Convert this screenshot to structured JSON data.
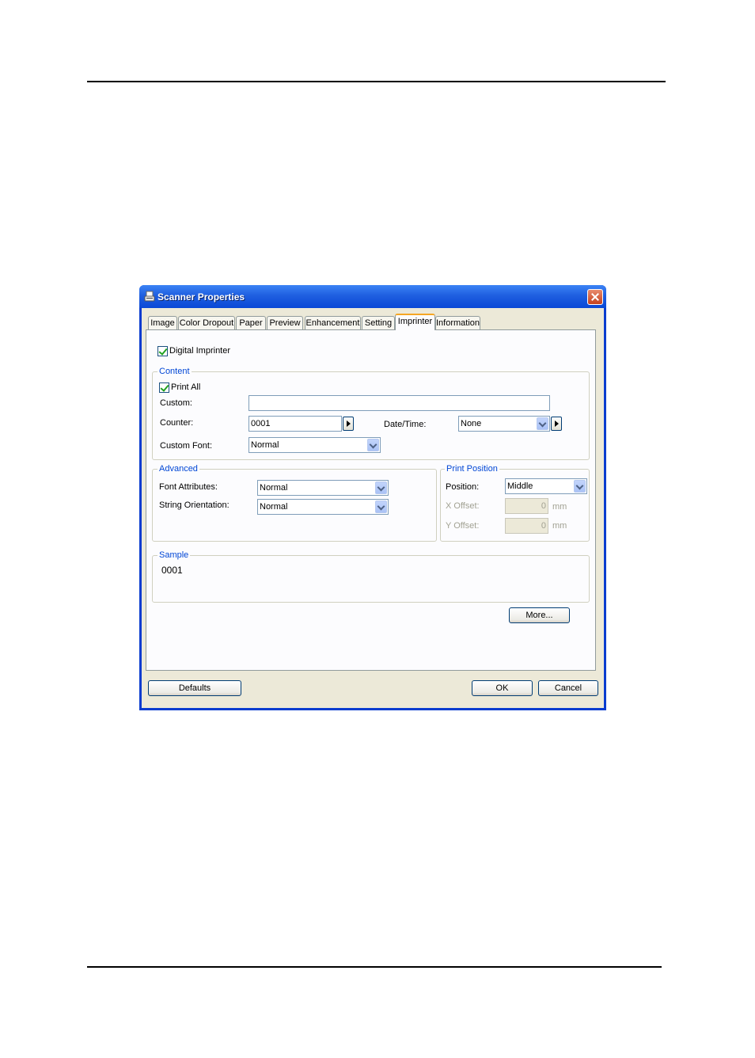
{
  "window": {
    "title": "Scanner Properties"
  },
  "tabs": [
    {
      "label": "Image"
    },
    {
      "label": "Color Dropout"
    },
    {
      "label": "Paper"
    },
    {
      "label": "Preview"
    },
    {
      "label": "Enhancement"
    },
    {
      "label": "Setting"
    },
    {
      "label": "Imprinter"
    },
    {
      "label": "Information"
    }
  ],
  "active_tab": "Imprinter",
  "digital_imprinter": {
    "label": "Digital Imprinter",
    "checked": true
  },
  "content": {
    "legend": "Content",
    "print_all": {
      "label": "Print All",
      "checked": true
    },
    "custom_label": "Custom:",
    "custom_value": "",
    "counter_label": "Counter:",
    "counter_value": "0001",
    "datetime_label": "Date/Time:",
    "datetime_value": "None",
    "custom_font_label": "Custom Font:",
    "custom_font_value": "Normal"
  },
  "advanced": {
    "legend": "Advanced",
    "font_attributes_label": "Font Attributes:",
    "font_attributes_value": "Normal",
    "string_orientation_label": "String Orientation:",
    "string_orientation_value": "Normal"
  },
  "print_position": {
    "legend": "Print Position",
    "position_label": "Position:",
    "position_value": "Middle",
    "x_offset_label": "X Offset:",
    "x_offset_value": "0",
    "y_offset_label": "Y Offset:",
    "y_offset_value": "0",
    "unit": "mm"
  },
  "sample": {
    "legend": "Sample",
    "text": "0001"
  },
  "buttons": {
    "more": "More...",
    "defaults": "Defaults",
    "ok": "OK",
    "cancel": "Cancel"
  },
  "icons": {
    "title_icon": "scanner-icon",
    "close": "close-icon"
  }
}
